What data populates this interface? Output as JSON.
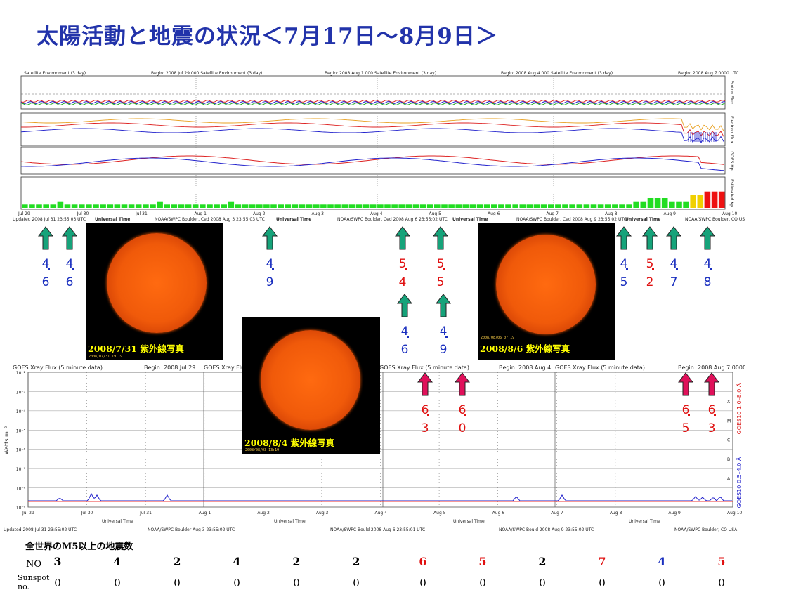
{
  "title": "太陽活動と地震の状況＜7月17日～8月9日＞",
  "top_panels": [
    {
      "header_left": "Satellite Environment (3 day)",
      "header_begin": "Begin:  2008 Jul 29 000 Satellite Environment (3 day)",
      "footer": "Updated 2008 Jul 31 23:55:03 UTC",
      "footer2": "NOAA/SWPC Boulder, Ced 2008 Aug  3 23:55:03 UTC",
      "dates": [
        "Jul 29",
        "Jul 30",
        "Jul 31",
        "Aug 1"
      ]
    },
    {
      "header_begin": "Begin:  2008 Aug 1 000 Satellite Environment (3 day)",
      "dates": [
        "Aug 2",
        "Aug 3",
        "Aug 4"
      ],
      "footer": "NOAA/SWPC Boulder, Ced 2008 Aug  6 23:55:02 UTC"
    },
    {
      "header_begin": "Begin:  2008 Aug 4 000 Satellite Environment (3 day)",
      "dates": [
        "Aug 5",
        "Aug 6",
        "Aug 7"
      ],
      "footer": "NOAA/SWPC Boulder, Ced 2008 Aug  9 23:55:02 UTC"
    },
    {
      "header_begin": "Begin:  2008 Aug 7 0000 UTC",
      "dates": [
        "Aug 8",
        "Aug 9",
        "Aug 10"
      ],
      "footer": "NOAA/SWPC Boulder, CO USA"
    }
  ],
  "top_universal_time": "Universal Time",
  "right_labels": [
    "Proton Flux",
    "Electron Flux",
    "GOES Hp",
    "Estimated Kp"
  ],
  "xray": {
    "header": "GOES Xray Flux (5 minute data)",
    "begins": [
      "Begin:  2008 Jul 29",
      "Begin:  2008 Aug 4",
      "Begin:  2008 Aug 7  0000 UTC"
    ],
    "ylabel": "Watts m⁻²",
    "yticks": [
      "10⁻²",
      "10⁻³",
      "10⁻⁴",
      "10⁻⁵",
      "10⁻⁶",
      "10⁻⁷",
      "10⁻⁸",
      "10⁻⁹"
    ],
    "classes": [
      "X",
      "M",
      "C",
      "B",
      "A"
    ],
    "right_label_red": "GOES10  1.0–8.0 Å",
    "right_label_blue": "GOES10  0.5–4.0 Å",
    "dates": [
      "Jul 29",
      "Jul 30",
      "Jul 31",
      "Aug 1",
      "Aug 2",
      "Aug 3",
      "Aug 4",
      "Aug 5",
      "Aug 6",
      "Aug 7",
      "Aug 8",
      "Aug 9",
      "Aug 10"
    ],
    "xlabel": "Universal Time",
    "footers": [
      "Updated 2008 Jul 31 23:55:02 UTC",
      "NOAA/SWPC Boulder Aug  3 23:55:02 UTC",
      "NOAA/SWPC Bould 2008 Aug  6 23:55:01 UTC",
      "NOAA/SWPC Bould 2008 Aug  9 23:55:02 UTC",
      "NOAA/SWPC Boulder, CO USA"
    ]
  },
  "sun_images": [
    {
      "caption": "2008/7/31 紫外線写真",
      "stamp": "2008/07/31 19:19"
    },
    {
      "caption": "2008/8/4 紫外線写真",
      "stamp": "2008/08/03 13:19"
    },
    {
      "caption": "2008/8/6 紫外線写真",
      "stamp": "2008/08/06 07:19"
    }
  ],
  "quakes": [
    {
      "color": "#16a37a",
      "d1": "4",
      "d2": "6",
      "cls": "blue"
    },
    {
      "color": "#16a37a",
      "d1": "4",
      "d2": "6",
      "cls": "blue"
    },
    {
      "color": "#16a37a",
      "d1": "4",
      "d2": "9",
      "cls": "blue"
    },
    {
      "color": "#16a37a",
      "d1": "5",
      "d2": "4",
      "cls": "red"
    },
    {
      "color": "#16a37a",
      "d1": "5",
      "d2": "5",
      "cls": "red"
    },
    {
      "color": "#16a37a",
      "d1": "4",
      "d2": "6",
      "cls": "blue"
    },
    {
      "color": "#16a37a",
      "d1": "4",
      "d2": "9",
      "cls": "blue"
    },
    {
      "color": "#16a37a",
      "d1": "4",
      "d2": "5",
      "cls": "blue"
    },
    {
      "color": "#16a37a",
      "d1": "5",
      "d2": "2",
      "cls": "red"
    },
    {
      "color": "#16a37a",
      "d1": "4",
      "d2": "7",
      "cls": "blue"
    },
    {
      "color": "#16a37a",
      "d1": "4",
      "d2": "8",
      "cls": "blue"
    },
    {
      "color": "#e0105a",
      "d1": "6",
      "d2": "3",
      "cls": "red"
    },
    {
      "color": "#e0105a",
      "d1": "6",
      "d2": "0",
      "cls": "red"
    },
    {
      "color": "#e0105a",
      "d1": "6",
      "d2": "5",
      "cls": "red"
    },
    {
      "color": "#e0105a",
      "d1": "6",
      "d2": "3",
      "cls": "red"
    }
  ],
  "chart_data": [
    {
      "type": "bar",
      "title": "Estimated Kp",
      "ylim": [
        0,
        9
      ],
      "xlabel": "Universal Time",
      "x_range": [
        "2008 Jul 29",
        "2008 Aug 10"
      ],
      "values": [
        1,
        1,
        1,
        1,
        1,
        2,
        1,
        1,
        1,
        1,
        1,
        1,
        1,
        1,
        1,
        1,
        1,
        1,
        1,
        2,
        1,
        1,
        1,
        1,
        1,
        1,
        1,
        1,
        1,
        2,
        1,
        1,
        1,
        1,
        1,
        1,
        1,
        1,
        1,
        1,
        1,
        1,
        1,
        1,
        1,
        1,
        1,
        1,
        1,
        1,
        1,
        1,
        1,
        1,
        1,
        1,
        1,
        1,
        1,
        1,
        1,
        1,
        1,
        1,
        1,
        1,
        1,
        1,
        1,
        1,
        1,
        1,
        1,
        1,
        1,
        1,
        1,
        1,
        1,
        1,
        1,
        1,
        1,
        1,
        1,
        1,
        2,
        2,
        3,
        3,
        3,
        2,
        2,
        2,
        4,
        4,
        5,
        5,
        5
      ],
      "colors": {
        "quiet": "#22dd22",
        "active": "#f0d000",
        "storm": "#ee1111"
      }
    },
    {
      "type": "table",
      "title": "全世界のM5以上の地震数",
      "rows": [
        {
          "label": "NO",
          "values": [
            "3",
            "4",
            "2",
            "4",
            "2",
            "2",
            "6",
            "5",
            "2",
            "7",
            "4",
            "5"
          ]
        },
        {
          "label": "Sunspot no.",
          "values": [
            "0",
            "0",
            "0",
            "0",
            "0",
            "0",
            "0",
            "0",
            "0",
            "0",
            "0",
            "0"
          ]
        }
      ],
      "value_colors": [
        "#000",
        "#000",
        "#000",
        "#000",
        "#000",
        "#000",
        "#e01010",
        "#e01010",
        "#000",
        "#e01010",
        "#1a2fbf",
        "#e01010"
      ]
    }
  ]
}
